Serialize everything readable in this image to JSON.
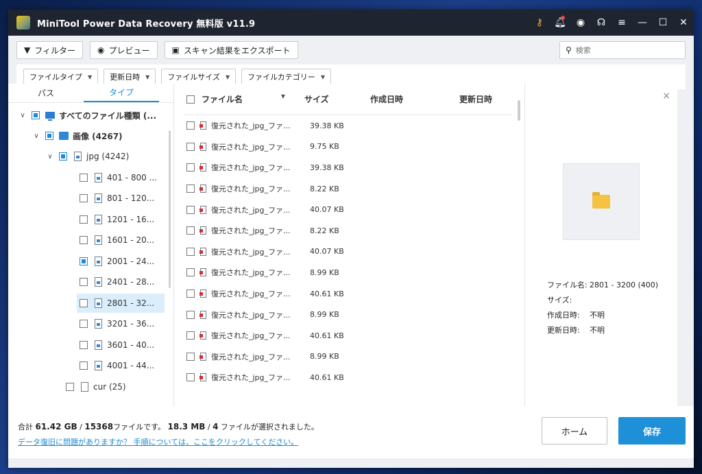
{
  "titlebar": {
    "title": "MiniTool Power Data Recovery 無料版 v11.9",
    "icons": [
      "key-icon",
      "bell-icon",
      "disc-icon",
      "headset-icon",
      "menu-icon",
      "minimize-icon",
      "maximize-icon",
      "close-icon"
    ]
  },
  "toolbar": {
    "filter_label": "フィルター",
    "preview_label": "プレビュー",
    "export_label": "スキャン結果をエクスポート",
    "search_placeholder": "検索"
  },
  "filters": [
    "ファイルタイプ",
    "更新日時",
    "ファイルサイズ",
    "ファイルカテゴリー"
  ],
  "tree": {
    "tabs": [
      "パス",
      "タイプ"
    ],
    "active_tab": "タイプ",
    "nodes": [
      {
        "label": "すべてのファイル種類 (...",
        "bold": true
      },
      {
        "label": "画像 (4267)",
        "bold": true
      },
      {
        "label": "jpg (4242)"
      },
      {
        "label": "401 - 800 ..."
      },
      {
        "label": "801 - 120..."
      },
      {
        "label": "1201 - 16..."
      },
      {
        "label": "1601 - 20..."
      },
      {
        "label": "2001 - 24...",
        "checked": true
      },
      {
        "label": "2401 - 28..."
      },
      {
        "label": "2801 - 32...",
        "selected": true
      },
      {
        "label": "3201 - 36..."
      },
      {
        "label": "3601 - 40..."
      },
      {
        "label": "4001 - 44..."
      },
      {
        "label": "cur (25)"
      }
    ]
  },
  "filelist": {
    "columns": [
      "ファイル名",
      "サイズ",
      "作成日時",
      "更新日時"
    ],
    "rows": [
      {
        "name": "復元された_jpg_ファ...",
        "size": "39.38 KB"
      },
      {
        "name": "復元された_jpg_ファ...",
        "size": "9.75 KB"
      },
      {
        "name": "復元された_jpg_ファ...",
        "size": "39.38 KB"
      },
      {
        "name": "復元された_jpg_ファ...",
        "size": "8.22 KB"
      },
      {
        "name": "復元された_jpg_ファ...",
        "size": "40.07 KB"
      },
      {
        "name": "復元された_jpg_ファ...",
        "size": "8.22 KB"
      },
      {
        "name": "復元された_jpg_ファ...",
        "size": "40.07 KB"
      },
      {
        "name": "復元された_jpg_ファ...",
        "size": "8.99 KB"
      },
      {
        "name": "復元された_jpg_ファ...",
        "size": "40.61 KB"
      },
      {
        "name": "復元された_jpg_ファ...",
        "size": "8.99 KB"
      },
      {
        "name": "復元された_jpg_ファ...",
        "size": "40.61 KB"
      },
      {
        "name": "復元された_jpg_ファ...",
        "size": "8.99 KB"
      },
      {
        "name": "復元された_jpg_ファ...",
        "size": "40.61 KB"
      }
    ]
  },
  "preview": {
    "filename_label": "ファイル名:",
    "filename_value": "2801 - 3200 (400)",
    "size_label": "サイズ:",
    "size_value": "",
    "created_label": "作成日時:",
    "created_value": "不明",
    "modified_label": "更新日時:",
    "modified_value": "不明"
  },
  "footer": {
    "total_prefix": "合計 ",
    "total_size": "61.42 GB",
    "total_sep": " / ",
    "total_files": "15368",
    "total_suffix": "ファイルです。 ",
    "selected_size": "18.3 MB",
    "selected_sep": " / ",
    "selected_files": "4",
    "selected_suffix": " ファイルが選択されました。",
    "help_link": "データ復旧に問題がありますか？ 手順については、ここをクリックしてください。",
    "home_label": "ホーム",
    "save_label": "保存"
  },
  "colors": {
    "accent": "#1e90d8",
    "titlebar": "#1f2530",
    "selected_row": "#dbeefb"
  }
}
